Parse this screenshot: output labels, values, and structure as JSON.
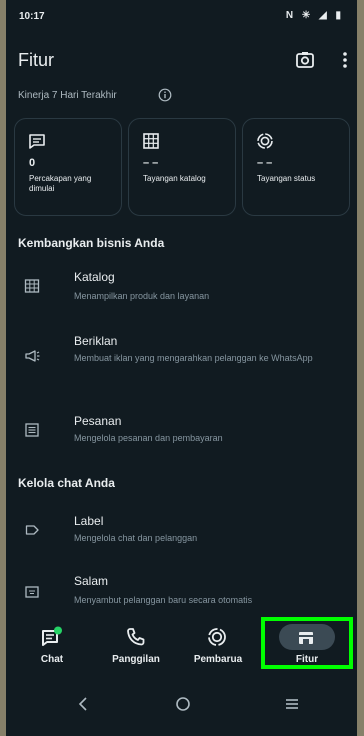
{
  "status_bar": {
    "time": "10:17",
    "icons": "N ✳ ◢ ▮"
  },
  "app_bar": {
    "title": "Fitur",
    "camera_icon": "camera-icon",
    "menu_icon": "more-vert-icon"
  },
  "performance": {
    "label": "Kinerja 7 Hari Terakhir",
    "cards": [
      {
        "icon": "chat-icon",
        "value": "0",
        "label": "Percakapan yang dimulai"
      },
      {
        "icon": "catalog-icon",
        "value": "– –",
        "label": "Tayangan katalog"
      },
      {
        "icon": "status-icon",
        "value": "– –",
        "label": "Tayangan status"
      }
    ]
  },
  "grow_section": {
    "title": "Kembangkan bisnis Anda",
    "items": [
      {
        "icon": "catalog-icon",
        "title": "Katalog",
        "desc": "Menampilkan produk dan layanan"
      },
      {
        "icon": "megaphone-icon",
        "title": "Beriklan",
        "desc": "Membuat iklan yang mengarahkan pelanggan ke WhatsApp"
      },
      {
        "icon": "orders-icon",
        "title": "Pesanan",
        "desc": "Mengelola pesanan dan pembayaran"
      }
    ]
  },
  "manage_section": {
    "title": "Kelola chat Anda",
    "items": [
      {
        "icon": "label-icon",
        "title": "Label",
        "desc": "Mengelola chat dan pelanggan"
      },
      {
        "icon": "greeting-icon",
        "title": "Salam",
        "desc": "Menyambut pelanggan baru secara otomatis"
      }
    ]
  },
  "bottom_nav": {
    "tabs": [
      {
        "label": "Chat",
        "icon": "chat-icon",
        "active": false
      },
      {
        "label": "Panggilan",
        "icon": "phone-icon",
        "active": false
      },
      {
        "label": "Pembarua",
        "icon": "updates-icon",
        "active": false
      },
      {
        "label": "Fitur",
        "icon": "storefront-icon",
        "active": true
      }
    ],
    "badge_color": "#25d366",
    "highlight_color": "#00ff00"
  },
  "system_nav": {
    "back_icon": "back-icon",
    "home_icon": "home-icon",
    "recents_icon": "recents-icon"
  }
}
